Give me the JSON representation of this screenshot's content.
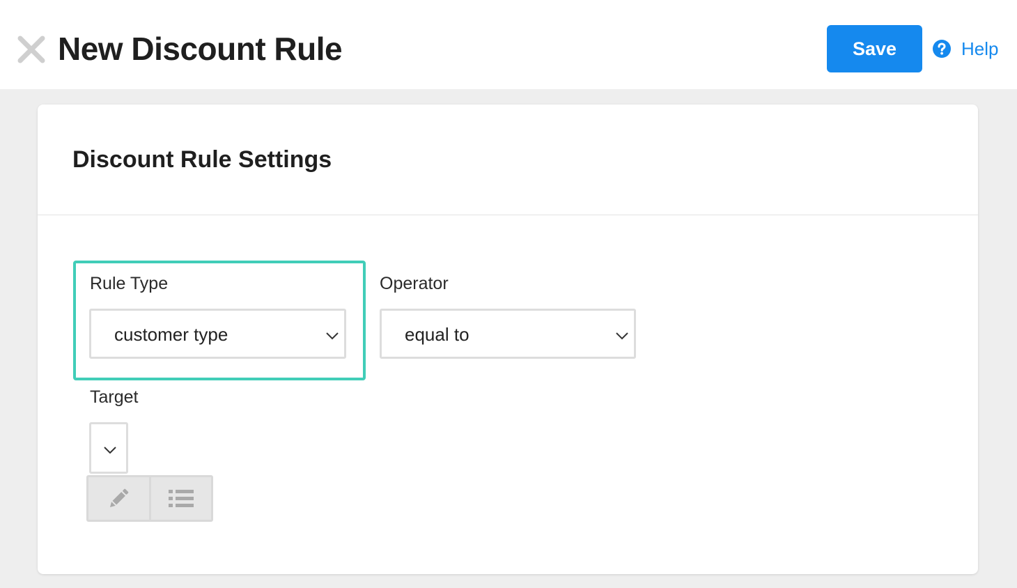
{
  "header": {
    "close_icon": "close-x-icon",
    "title": "New Discount Rule",
    "save_label": "Save",
    "help_label": "Help",
    "help_icon": "question-circle-icon"
  },
  "card": {
    "title": "Discount Rule Settings",
    "fields": {
      "rule_type": {
        "label": "Rule Type",
        "value": "customer type",
        "highlighted": true
      },
      "operator": {
        "label": "Operator",
        "value": "equal to"
      },
      "target": {
        "label": "Target",
        "value": ""
      }
    },
    "target_modes": [
      {
        "name": "edit-mode",
        "icon": "pencil-icon"
      },
      {
        "name": "list-mode",
        "icon": "list-icon"
      }
    ]
  },
  "colors": {
    "accent": "#1589ee",
    "highlight": "#41cdb8",
    "background": "#eeeeee",
    "surface": "#ffffff"
  }
}
